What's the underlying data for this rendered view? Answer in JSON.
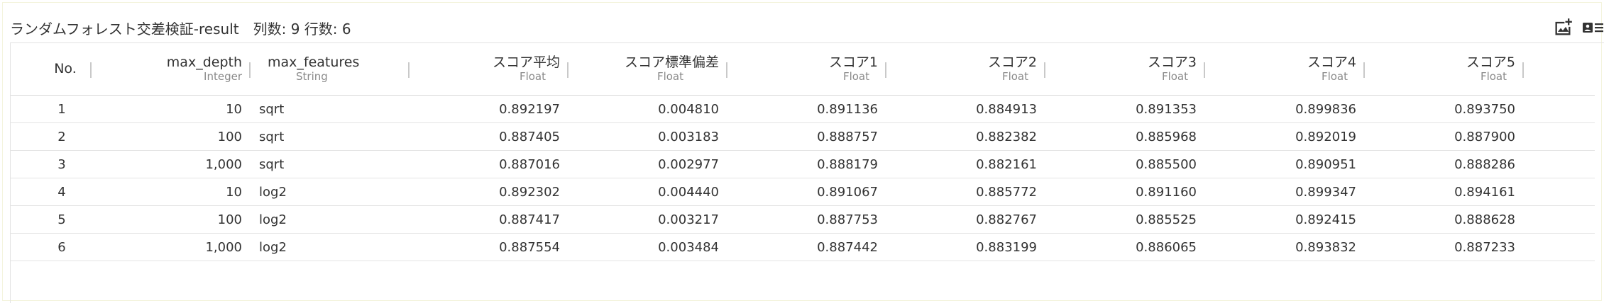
{
  "header": {
    "title": "ランダムフォレスト交差検証-result",
    "meta": "列数: 9 行数: 6"
  },
  "toolbar": {
    "icons": [
      "add-image-icon",
      "card-list-icon"
    ]
  },
  "table": {
    "columns": [
      {
        "name": "No.",
        "type": ""
      },
      {
        "name": "max_depth",
        "type": "Integer"
      },
      {
        "name": "max_features",
        "type": "String"
      },
      {
        "name": "スコア平均",
        "type": "Float"
      },
      {
        "name": "スコア標準偏差",
        "type": "Float"
      },
      {
        "name": "スコア1",
        "type": "Float"
      },
      {
        "name": "スコア2",
        "type": "Float"
      },
      {
        "name": "スコア3",
        "type": "Float"
      },
      {
        "name": "スコア4",
        "type": "Float"
      },
      {
        "name": "スコア5",
        "type": "Float"
      }
    ],
    "rows": [
      [
        "1",
        "10",
        "sqrt",
        "0.892197",
        "0.004810",
        "0.891136",
        "0.884913",
        "0.891353",
        "0.899836",
        "0.893750"
      ],
      [
        "2",
        "100",
        "sqrt",
        "0.887405",
        "0.003183",
        "0.888757",
        "0.882382",
        "0.885968",
        "0.892019",
        "0.887900"
      ],
      [
        "3",
        "1,000",
        "sqrt",
        "0.887016",
        "0.002977",
        "0.888179",
        "0.882161",
        "0.885500",
        "0.890951",
        "0.888286"
      ],
      [
        "4",
        "10",
        "log2",
        "0.892302",
        "0.004440",
        "0.891067",
        "0.885772",
        "0.891160",
        "0.899347",
        "0.894161"
      ],
      [
        "5",
        "100",
        "log2",
        "0.887417",
        "0.003217",
        "0.887753",
        "0.882767",
        "0.885525",
        "0.892415",
        "0.888628"
      ],
      [
        "6",
        "1,000",
        "log2",
        "0.887554",
        "0.003484",
        "0.887442",
        "0.883199",
        "0.886065",
        "0.893832",
        "0.887233"
      ]
    ]
  }
}
